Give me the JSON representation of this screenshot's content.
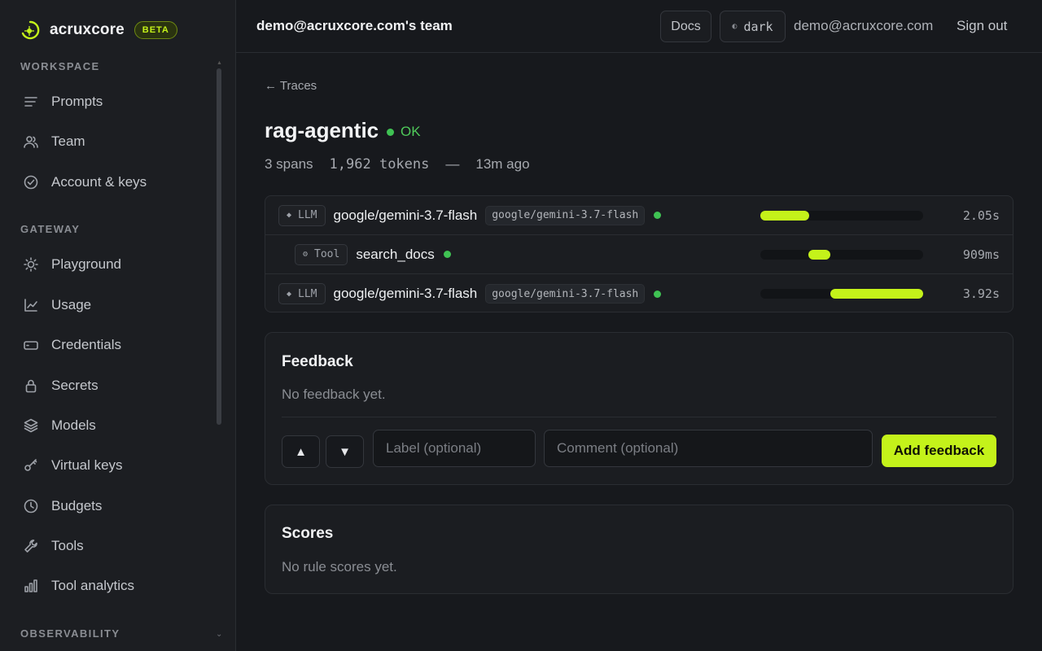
{
  "brand": {
    "name": "acruxcore",
    "badge": "BETA"
  },
  "sidebar": {
    "sections": [
      {
        "label": "WORKSPACE",
        "items": [
          {
            "label": "Prompts",
            "icon": "lines-icon"
          },
          {
            "label": "Team",
            "icon": "users-icon"
          },
          {
            "label": "Account & keys",
            "icon": "check-circle-icon"
          }
        ]
      },
      {
        "label": "GATEWAY",
        "items": [
          {
            "label": "Playground",
            "icon": "sun-icon"
          },
          {
            "label": "Usage",
            "icon": "chart-line-icon"
          },
          {
            "label": "Credentials",
            "icon": "card-icon"
          },
          {
            "label": "Secrets",
            "icon": "lock-icon"
          },
          {
            "label": "Models",
            "icon": "layers-icon"
          },
          {
            "label": "Virtual keys",
            "icon": "key-icon"
          },
          {
            "label": "Budgets",
            "icon": "clock-icon"
          },
          {
            "label": "Tools",
            "icon": "wrench-icon"
          },
          {
            "label": "Tool analytics",
            "icon": "bar-chart-icon"
          }
        ]
      },
      {
        "label": "OBSERVABILITY",
        "items": []
      }
    ]
  },
  "header": {
    "team": "demo@acruxcore.com's team",
    "docs": "Docs",
    "theme": "dark",
    "theme_glyph": "◐",
    "email": "demo@acruxcore.com",
    "signout": "Sign out"
  },
  "trace": {
    "back": "← Traces",
    "name": "rag-agentic",
    "status": "OK",
    "spans_count": "3 spans",
    "tokens": "1,962 tokens",
    "sep": "—",
    "age": "13m ago",
    "spans": [
      {
        "kind": "LLM",
        "glyph": "◆",
        "name": "google/gemini-3.7-flash",
        "model": "google/gemini-3.7-flash",
        "duration": "2.05s",
        "bar_start": 0.0,
        "bar_end": 0.3
      },
      {
        "kind": "Tool",
        "glyph": "⚙",
        "name": "search_docs",
        "model": "",
        "duration": "909ms",
        "bar_start": 0.295,
        "bar_end": 0.43
      },
      {
        "kind": "LLM",
        "glyph": "◆",
        "name": "google/gemini-3.7-flash",
        "model": "google/gemini-3.7-flash",
        "duration": "3.92s",
        "bar_start": 0.43,
        "bar_end": 1.0
      }
    ]
  },
  "feedback": {
    "title": "Feedback",
    "empty": "No feedback yet.",
    "up": "▲",
    "down": "▼",
    "label_placeholder": "Label (optional)",
    "comment_placeholder": "Comment (optional)",
    "submit": "Add feedback"
  },
  "scores": {
    "title": "Scores",
    "empty": "No rule scores yet."
  },
  "colors": {
    "accent": "#c4f21a",
    "ok": "#3fc253",
    "bg": "#17191d",
    "sidebar": "#1c1e22"
  }
}
